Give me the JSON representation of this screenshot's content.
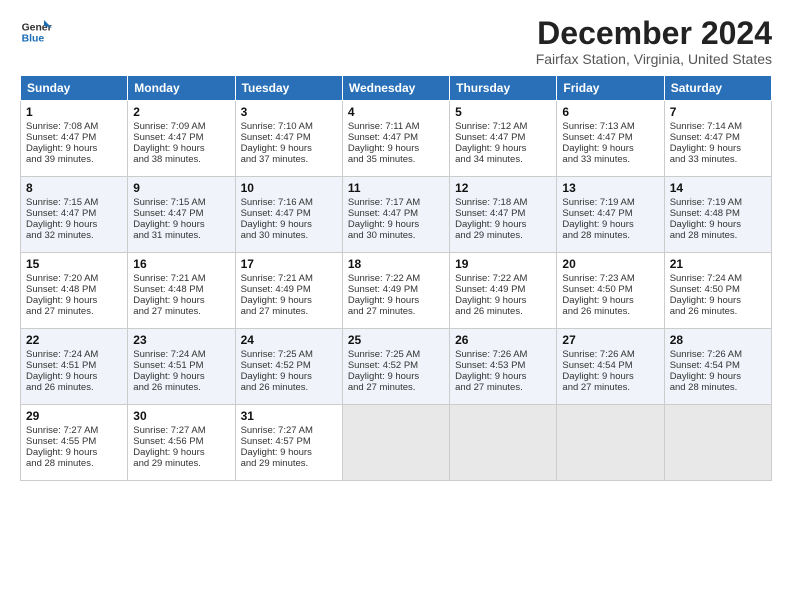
{
  "logo": {
    "line1": "General",
    "line2": "Blue"
  },
  "title": "December 2024",
  "subtitle": "Fairfax Station, Virginia, United States",
  "days_header": [
    "Sunday",
    "Monday",
    "Tuesday",
    "Wednesday",
    "Thursday",
    "Friday",
    "Saturday"
  ],
  "weeks": [
    [
      {
        "day": "1",
        "lines": [
          "Sunrise: 7:08 AM",
          "Sunset: 4:47 PM",
          "Daylight: 9 hours",
          "and 39 minutes."
        ]
      },
      {
        "day": "2",
        "lines": [
          "Sunrise: 7:09 AM",
          "Sunset: 4:47 PM",
          "Daylight: 9 hours",
          "and 38 minutes."
        ]
      },
      {
        "day": "3",
        "lines": [
          "Sunrise: 7:10 AM",
          "Sunset: 4:47 PM",
          "Daylight: 9 hours",
          "and 37 minutes."
        ]
      },
      {
        "day": "4",
        "lines": [
          "Sunrise: 7:11 AM",
          "Sunset: 4:47 PM",
          "Daylight: 9 hours",
          "and 35 minutes."
        ]
      },
      {
        "day": "5",
        "lines": [
          "Sunrise: 7:12 AM",
          "Sunset: 4:47 PM",
          "Daylight: 9 hours",
          "and 34 minutes."
        ]
      },
      {
        "day": "6",
        "lines": [
          "Sunrise: 7:13 AM",
          "Sunset: 4:47 PM",
          "Daylight: 9 hours",
          "and 33 minutes."
        ]
      },
      {
        "day": "7",
        "lines": [
          "Sunrise: 7:14 AM",
          "Sunset: 4:47 PM",
          "Daylight: 9 hours",
          "and 33 minutes."
        ]
      }
    ],
    [
      {
        "day": "8",
        "lines": [
          "Sunrise: 7:15 AM",
          "Sunset: 4:47 PM",
          "Daylight: 9 hours",
          "and 32 minutes."
        ]
      },
      {
        "day": "9",
        "lines": [
          "Sunrise: 7:15 AM",
          "Sunset: 4:47 PM",
          "Daylight: 9 hours",
          "and 31 minutes."
        ]
      },
      {
        "day": "10",
        "lines": [
          "Sunrise: 7:16 AM",
          "Sunset: 4:47 PM",
          "Daylight: 9 hours",
          "and 30 minutes."
        ]
      },
      {
        "day": "11",
        "lines": [
          "Sunrise: 7:17 AM",
          "Sunset: 4:47 PM",
          "Daylight: 9 hours",
          "and 30 minutes."
        ]
      },
      {
        "day": "12",
        "lines": [
          "Sunrise: 7:18 AM",
          "Sunset: 4:47 PM",
          "Daylight: 9 hours",
          "and 29 minutes."
        ]
      },
      {
        "day": "13",
        "lines": [
          "Sunrise: 7:19 AM",
          "Sunset: 4:47 PM",
          "Daylight: 9 hours",
          "and 28 minutes."
        ]
      },
      {
        "day": "14",
        "lines": [
          "Sunrise: 7:19 AM",
          "Sunset: 4:48 PM",
          "Daylight: 9 hours",
          "and 28 minutes."
        ]
      }
    ],
    [
      {
        "day": "15",
        "lines": [
          "Sunrise: 7:20 AM",
          "Sunset: 4:48 PM",
          "Daylight: 9 hours",
          "and 27 minutes."
        ]
      },
      {
        "day": "16",
        "lines": [
          "Sunrise: 7:21 AM",
          "Sunset: 4:48 PM",
          "Daylight: 9 hours",
          "and 27 minutes."
        ]
      },
      {
        "day": "17",
        "lines": [
          "Sunrise: 7:21 AM",
          "Sunset: 4:49 PM",
          "Daylight: 9 hours",
          "and 27 minutes."
        ]
      },
      {
        "day": "18",
        "lines": [
          "Sunrise: 7:22 AM",
          "Sunset: 4:49 PM",
          "Daylight: 9 hours",
          "and 27 minutes."
        ]
      },
      {
        "day": "19",
        "lines": [
          "Sunrise: 7:22 AM",
          "Sunset: 4:49 PM",
          "Daylight: 9 hours",
          "and 26 minutes."
        ]
      },
      {
        "day": "20",
        "lines": [
          "Sunrise: 7:23 AM",
          "Sunset: 4:50 PM",
          "Daylight: 9 hours",
          "and 26 minutes."
        ]
      },
      {
        "day": "21",
        "lines": [
          "Sunrise: 7:24 AM",
          "Sunset: 4:50 PM",
          "Daylight: 9 hours",
          "and 26 minutes."
        ]
      }
    ],
    [
      {
        "day": "22",
        "lines": [
          "Sunrise: 7:24 AM",
          "Sunset: 4:51 PM",
          "Daylight: 9 hours",
          "and 26 minutes."
        ]
      },
      {
        "day": "23",
        "lines": [
          "Sunrise: 7:24 AM",
          "Sunset: 4:51 PM",
          "Daylight: 9 hours",
          "and 26 minutes."
        ]
      },
      {
        "day": "24",
        "lines": [
          "Sunrise: 7:25 AM",
          "Sunset: 4:52 PM",
          "Daylight: 9 hours",
          "and 26 minutes."
        ]
      },
      {
        "day": "25",
        "lines": [
          "Sunrise: 7:25 AM",
          "Sunset: 4:52 PM",
          "Daylight: 9 hours",
          "and 27 minutes."
        ]
      },
      {
        "day": "26",
        "lines": [
          "Sunrise: 7:26 AM",
          "Sunset: 4:53 PM",
          "Daylight: 9 hours",
          "and 27 minutes."
        ]
      },
      {
        "day": "27",
        "lines": [
          "Sunrise: 7:26 AM",
          "Sunset: 4:54 PM",
          "Daylight: 9 hours",
          "and 27 minutes."
        ]
      },
      {
        "day": "28",
        "lines": [
          "Sunrise: 7:26 AM",
          "Sunset: 4:54 PM",
          "Daylight: 9 hours",
          "and 28 minutes."
        ]
      }
    ],
    [
      {
        "day": "29",
        "lines": [
          "Sunrise: 7:27 AM",
          "Sunset: 4:55 PM",
          "Daylight: 9 hours",
          "and 28 minutes."
        ]
      },
      {
        "day": "30",
        "lines": [
          "Sunrise: 7:27 AM",
          "Sunset: 4:56 PM",
          "Daylight: 9 hours",
          "and 29 minutes."
        ]
      },
      {
        "day": "31",
        "lines": [
          "Sunrise: 7:27 AM",
          "Sunset: 4:57 PM",
          "Daylight: 9 hours",
          "and 29 minutes."
        ]
      },
      null,
      null,
      null,
      null
    ]
  ]
}
